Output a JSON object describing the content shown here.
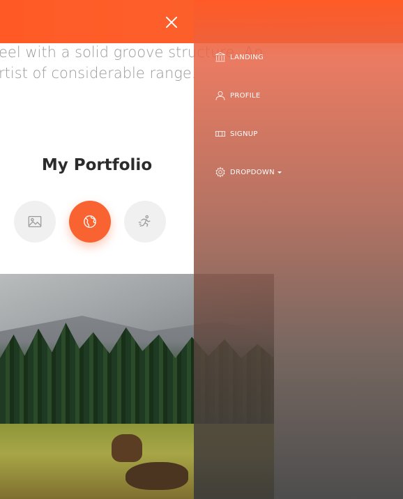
{
  "bio": {
    "line1": "eel with a solid groove structure. An",
    "line2": "rtist of considerable range."
  },
  "portfolio": {
    "title": "My Portfolio",
    "tabs": [
      {
        "icon": "image-icon",
        "active": false
      },
      {
        "icon": "world-icon",
        "active": true
      },
      {
        "icon": "running-icon",
        "active": false
      }
    ]
  },
  "nav": {
    "items": [
      {
        "label": "LANDING",
        "icon": "bank-icon"
      },
      {
        "label": "PROFILE",
        "icon": "user-icon"
      },
      {
        "label": "SIGNUP",
        "icon": "ticket-icon"
      },
      {
        "label": "DROPDOWN",
        "icon": "settings-icon"
      }
    ]
  },
  "colors": {
    "accent": "#f96332",
    "text_muted": "#9a9a9a",
    "title": "#2c2c2c",
    "tab_bg": "#f0f0f0"
  }
}
